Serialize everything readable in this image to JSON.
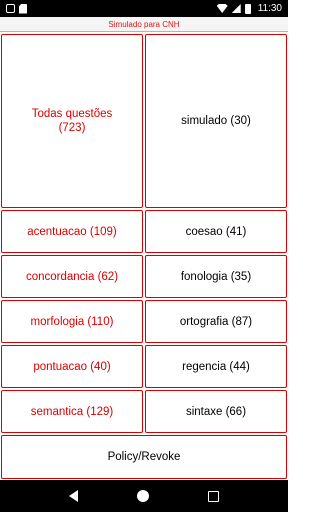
{
  "status_bar": {
    "time": "11:30"
  },
  "title": "Simulado para CNH",
  "main": {
    "all_questions": "Todas questões\n(723)",
    "simulado": "simulado (30)",
    "topics": [
      {
        "left": "acentuacao (109)",
        "right": "coesao (41)"
      },
      {
        "left": "concordancia (62)",
        "right": "fonologia (35)"
      },
      {
        "left": "morfologia (110)",
        "right": "ortografia (87)"
      },
      {
        "left": "pontuacao (40)",
        "right": "regencia (44)"
      },
      {
        "left": "semantica (129)",
        "right": "sintaxe (66)"
      }
    ],
    "policy": "Policy/Revoke"
  },
  "colors": {
    "accent": "#d80000",
    "title_text": "#d81818"
  }
}
